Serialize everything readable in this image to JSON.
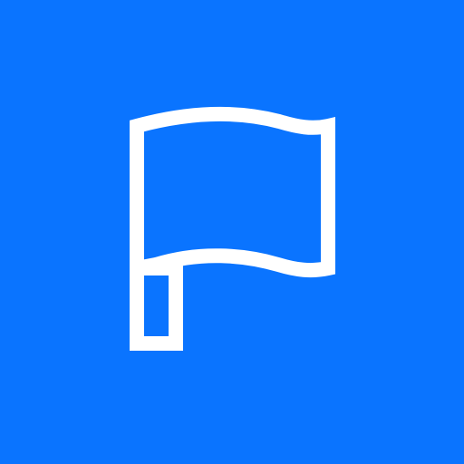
{
  "app_icon": {
    "icon": "flag-icon",
    "background_color": "#0A74FF",
    "glyph_color": "#FFFFFF"
  }
}
